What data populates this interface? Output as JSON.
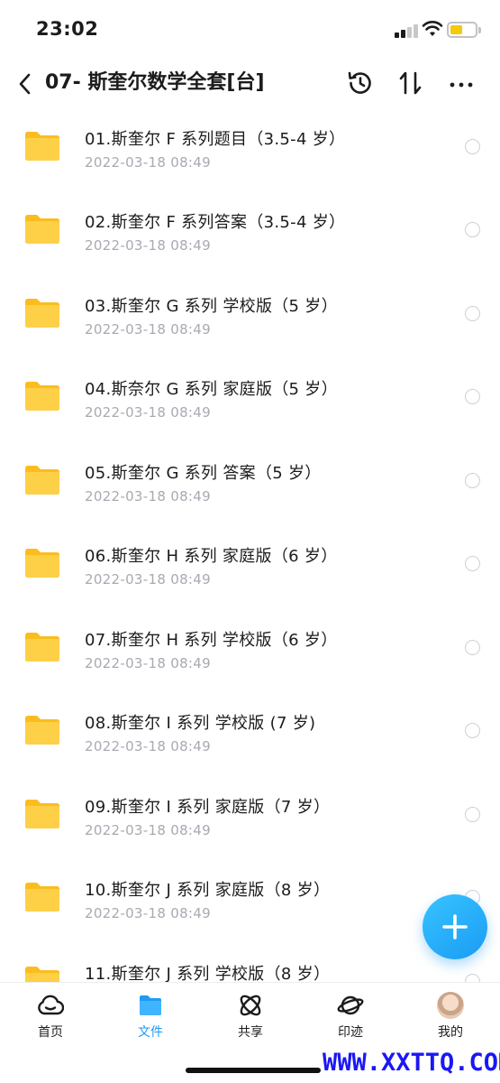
{
  "status_bar": {
    "time": "23:02"
  },
  "header": {
    "title": "07- 斯奎尔数学全套[台]"
  },
  "files": [
    {
      "name": "01.斯奎尔 F 系列题目（3.5-4 岁）",
      "date": "2022-03-18 08:49"
    },
    {
      "name": "02.斯奎尔 F 系列答案（3.5-4 岁）",
      "date": "2022-03-18 08:49"
    },
    {
      "name": "03.斯奎尔 G 系列 学校版（5 岁）",
      "date": "2022-03-18 08:49"
    },
    {
      "name": "04.斯奈尔 G 系列 家庭版（5 岁）",
      "date": "2022-03-18 08:49"
    },
    {
      "name": "05.斯奎尔 G 系列 答案（5 岁）",
      "date": "2022-03-18 08:49"
    },
    {
      "name": "06.斯奎尔 H 系列 家庭版（6 岁）",
      "date": "2022-03-18 08:49"
    },
    {
      "name": "07.斯奎尔 H 系列 学校版（6 岁）",
      "date": "2022-03-18 08:49"
    },
    {
      "name": "08.斯奎尔 I 系列 学校版 (7 岁)",
      "date": "2022-03-18 08:49"
    },
    {
      "name": "09.斯奎尔 I 系列 家庭版（7 岁）",
      "date": "2022-03-18 08:49"
    },
    {
      "name": "10.斯奎尔 J 系列 家庭版（8 岁）",
      "date": "2022-03-18 08:49"
    },
    {
      "name": "11.斯奎尔 J 系列 学校版（8 岁）",
      "date": ""
    }
  ],
  "tabs": [
    {
      "label": "首页",
      "icon": "cloud-icon"
    },
    {
      "label": "文件",
      "icon": "folder-icon",
      "active": true
    },
    {
      "label": "共享",
      "icon": "share-atom-icon"
    },
    {
      "label": "印迹",
      "icon": "planet-icon"
    },
    {
      "label": "我的",
      "icon": "avatar"
    }
  ],
  "watermark": "WWW.XXTTQ.COM",
  "colors": {
    "accent": "#1f9bf3",
    "folder": "#fdc92c",
    "watermark": "#1b17f5"
  }
}
